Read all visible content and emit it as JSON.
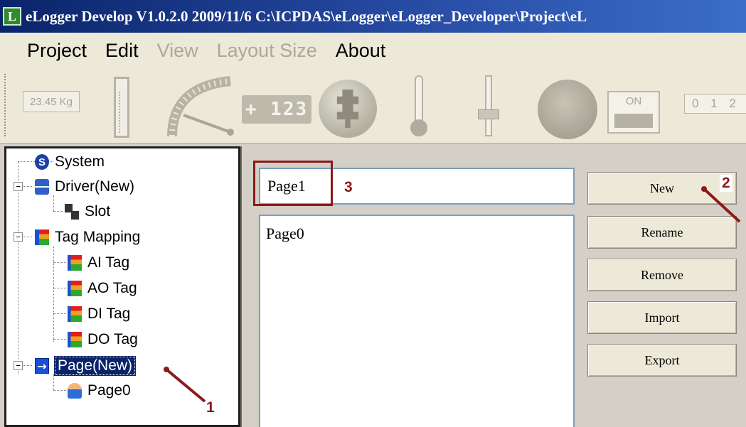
{
  "window": {
    "app_icon_letter": "L",
    "title": "eLogger Develop V1.0.2.0  2009/11/6  C:\\ICPDAS\\eLogger\\eLogger_Developer\\Project\\eL"
  },
  "menu": {
    "items": [
      {
        "label": "Project",
        "enabled": true
      },
      {
        "label": "Edit",
        "enabled": true
      },
      {
        "label": "View",
        "enabled": false
      },
      {
        "label": "Layout Size",
        "enabled": false
      },
      {
        "label": "About",
        "enabled": true
      }
    ]
  },
  "toolbar": {
    "weight_display": "23.45 Kg",
    "digital_display": "+ 123",
    "switch_label": "ON",
    "digits_display": "0 1 2"
  },
  "tree": {
    "system": "System",
    "driver": "Driver(New)",
    "slot": "Slot",
    "tag_mapping": "Tag Mapping",
    "ai_tag": "AI Tag",
    "ao_tag": "AO Tag",
    "di_tag": "DI Tag",
    "do_tag": "DO Tag",
    "page_new": "Page(New)",
    "page0": "Page0",
    "expanders": {
      "driver": "−",
      "tag_mapping": "−",
      "page": "−"
    }
  },
  "page_editor": {
    "name_value": "Page1",
    "list_items": [
      "Page0"
    ]
  },
  "buttons": {
    "new": "New",
    "rename": "Rename",
    "remove": "Remove",
    "import": "Import",
    "export": "Export"
  },
  "annotations": {
    "one": "1",
    "two": "2",
    "three": "3",
    "color": "#8b1a1a"
  }
}
